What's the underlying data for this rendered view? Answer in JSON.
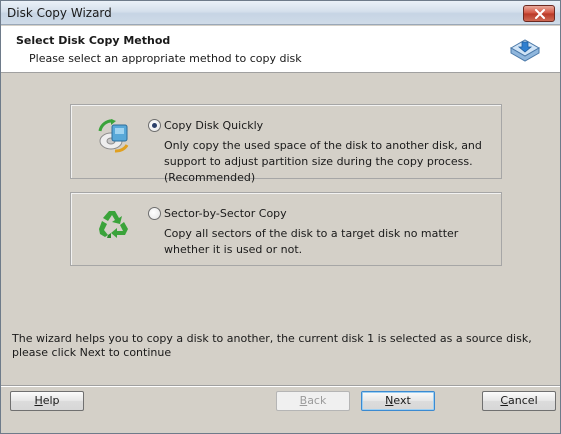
{
  "window": {
    "title": "Disk Copy Wizard"
  },
  "header": {
    "title": "Select Disk Copy Method",
    "subtitle": "Please select an appropriate method to copy disk"
  },
  "options": [
    {
      "label": "Copy Disk Quickly",
      "description": "Only copy the used space of the disk to another disk, and support to adjust partition size during the copy process.(Recommended)",
      "selected": true,
      "icon": "disk-copy-icon"
    },
    {
      "label": "Sector-by-Sector Copy",
      "description": "Copy all sectors of the disk to a target disk no matter whether it is used or not.",
      "selected": false,
      "icon": "recycle-icon"
    }
  ],
  "info": "The wizard helps you to copy a disk to another, the current disk 1 is selected as a source disk, please click Next to continue",
  "buttons": {
    "help": {
      "first": "H",
      "rest": "elp"
    },
    "back": {
      "first": "B",
      "rest": "ack",
      "enabled": false
    },
    "next": {
      "first": "N",
      "rest": "ext"
    },
    "cancel": {
      "first": "C",
      "rest": "ancel"
    }
  },
  "colors": {
    "accent": "#3b8ad1",
    "radio_dot": "#2b3f69",
    "recycle_green": "#3aa33a"
  }
}
